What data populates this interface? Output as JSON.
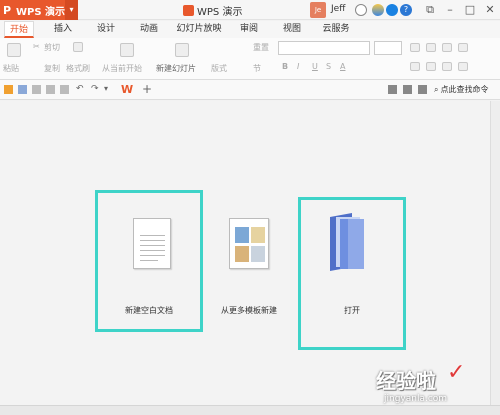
{
  "app": {
    "name": "WPS 演示",
    "doc_title": "WPS 演示",
    "user": "Jeff",
    "avatar_text": "Je"
  },
  "tabs": [
    {
      "label": "开始",
      "active": true
    },
    {
      "label": "插入"
    },
    {
      "label": "设计"
    },
    {
      "label": "动画"
    },
    {
      "label": "幻灯片放映"
    },
    {
      "label": "审阅"
    },
    {
      "label": "视图"
    },
    {
      "label": "云服务"
    }
  ],
  "ribbon": {
    "paste": "粘贴",
    "cut": "剪切",
    "copy": "复制",
    "format_painter": "格式刷",
    "from_current": "从当前开始",
    "new_slide": "新建幻灯片",
    "layout": "版式",
    "section": "节",
    "reset": "重置",
    "bold": "B",
    "italic": "I",
    "underline": "U",
    "strike": "S",
    "font_color": "A"
  },
  "quick_access": {
    "search_label": "点此查找命令"
  },
  "start_page": {
    "new_blank": "新建空白文档",
    "from_template": "从更多模板新建",
    "open": "打开"
  },
  "watermark": {
    "text": "经验啦",
    "url": "jingyanla.com"
  },
  "colors": {
    "accent": "#e8582c",
    "highlight": "#3ed3c8",
    "folder": "#6e8fe0"
  }
}
